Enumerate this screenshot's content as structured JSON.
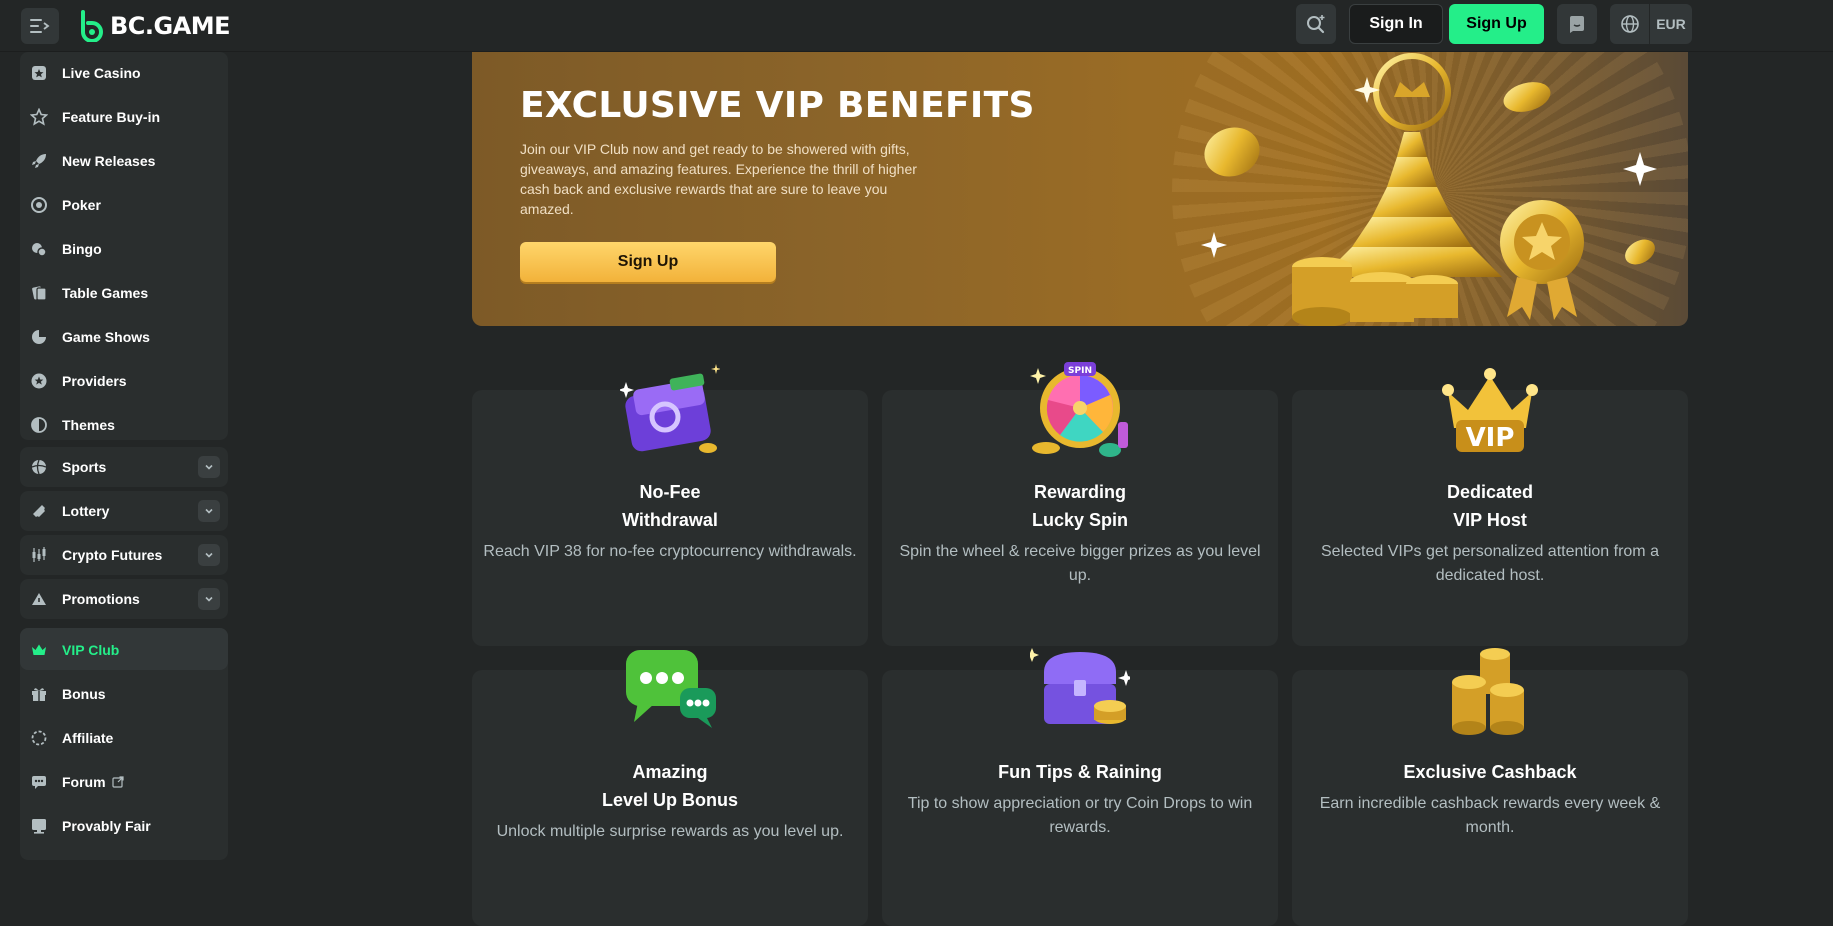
{
  "header": {
    "logo_text": "BC.GAME",
    "signin_label": "Sign In",
    "signup_label": "Sign Up",
    "currency": "EUR",
    "accent_color": "#24ee89"
  },
  "sidebar": {
    "items": [
      {
        "label": "Live Casino",
        "icon": "live-casino-icon"
      },
      {
        "label": "Feature Buy-in",
        "icon": "star-icon"
      },
      {
        "label": "New Releases",
        "icon": "rocket-icon"
      },
      {
        "label": "Poker",
        "icon": "poker-chip-icon"
      },
      {
        "label": "Bingo",
        "icon": "bingo-icon"
      },
      {
        "label": "Table Games",
        "icon": "table-games-icon"
      },
      {
        "label": "Game Shows",
        "icon": "game-shows-icon"
      },
      {
        "label": "Providers",
        "icon": "providers-icon"
      },
      {
        "label": "Themes",
        "icon": "themes-icon"
      },
      {
        "label": "Sports",
        "icon": "sports-ball-icon"
      },
      {
        "label": "Lottery",
        "icon": "lottery-ticket-icon"
      },
      {
        "label": "Crypto Futures",
        "icon": "candlestick-icon"
      },
      {
        "label": "Promotions",
        "icon": "promotions-icon"
      },
      {
        "label": "VIP Club",
        "icon": "crown-icon"
      },
      {
        "label": "Bonus",
        "icon": "gift-icon"
      },
      {
        "label": "Affiliate",
        "icon": "affiliate-icon"
      },
      {
        "label": "Forum",
        "icon": "forum-icon"
      },
      {
        "label": "Provably Fair",
        "icon": "provably-fair-icon"
      }
    ]
  },
  "hero": {
    "title": "EXCLUSIVE VIP BENEFITS",
    "description": "Join our VIP Club now and get ready to be showered with gifts, giveaways, and amazing features. Experience the thrill of higher cash back and exclusive rewards that are sure to leave you amazed.",
    "button_label": "Sign Up"
  },
  "benefits": [
    {
      "title_line1": "No-Fee",
      "title_line2": "Withdrawal",
      "desc": "Reach VIP 38 for no-fee cryptocurrency withdrawals.",
      "icon": "wallet-icon"
    },
    {
      "title_line1": "Rewarding",
      "title_line2": "Lucky Spin",
      "desc": "Spin the wheel & receive bigger prizes as you level up.",
      "icon": "spin-wheel-icon",
      "icon_text": "SPIN"
    },
    {
      "title_line1": "Dedicated",
      "title_line2": "VIP Host",
      "desc": "Selected VIPs get personalized attention from a dedicated host.",
      "icon": "vip-crown-icon",
      "icon_text": "VIP"
    },
    {
      "title_line1": "Amazing",
      "title_line2": "Level Up Bonus",
      "desc": "Unlock multiple surprise rewards as you level up.",
      "icon": "chat-bubbles-icon"
    },
    {
      "title_line1": "Fun Tips & Raining",
      "title_line2": "",
      "desc": "Tip to show appreciation or try Coin Drops to win rewards.",
      "icon": "treasure-chest-icon"
    },
    {
      "title_line1": "Exclusive Cashback",
      "title_line2": "",
      "desc": "Earn incredible cashback rewards every week & month.",
      "icon": "coin-stacks-icon"
    }
  ]
}
